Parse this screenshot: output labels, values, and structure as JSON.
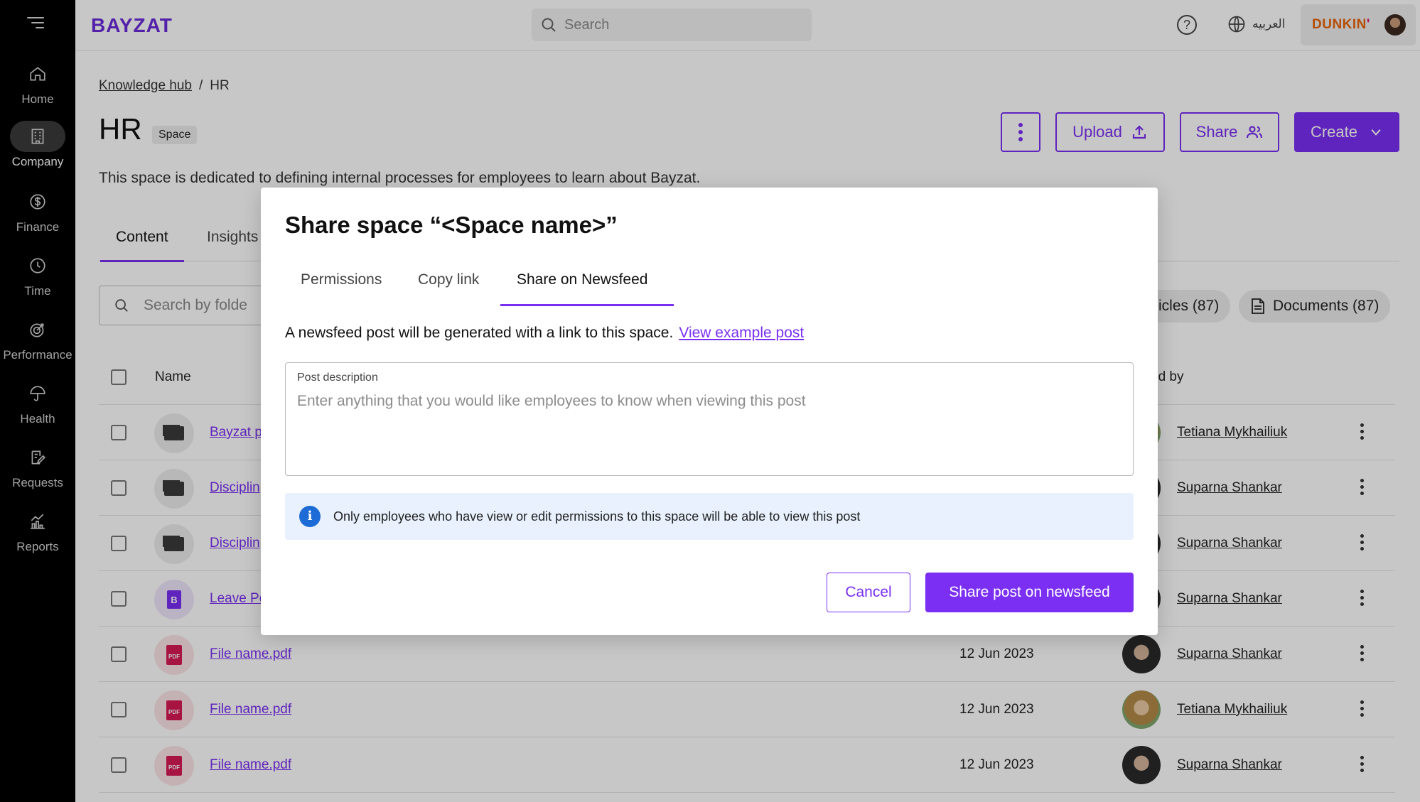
{
  "sidebar": {
    "items": [
      {
        "label": "Home",
        "icon": "home-icon"
      },
      {
        "label": "Company",
        "icon": "building-icon",
        "active": true
      },
      {
        "label": "Finance",
        "icon": "dollar-icon"
      },
      {
        "label": "Time",
        "icon": "clock-icon"
      },
      {
        "label": "Performance",
        "icon": "target-icon"
      },
      {
        "label": "Health",
        "icon": "umbrella-icon"
      },
      {
        "label": "Requests",
        "icon": "edit-icon"
      },
      {
        "label": "Reports",
        "icon": "bar-chart-icon"
      }
    ]
  },
  "topbar": {
    "logo": "BAYZAT",
    "search_placeholder": "Search",
    "help": "?",
    "language": "العربيه",
    "company_brand": "DUNKIN",
    "company_brand_suffix": "'"
  },
  "page": {
    "breadcrumb": [
      "Knowledge hub",
      "/",
      "HR"
    ],
    "title": "HR",
    "badge": "Space",
    "description": "This space is dedicated to defining internal processes for employees to learn about Bayzat.",
    "actions": {
      "upload": "Upload",
      "share": "Share",
      "create": "Create"
    },
    "tabs": [
      "Content",
      "Insights"
    ],
    "filter_placeholder": "Search by folde",
    "chips": [
      "icles (87)",
      "Documents (87)"
    ]
  },
  "table": {
    "headers": {
      "name": "Name",
      "by": "ed by"
    },
    "rows": [
      {
        "name": "Bayzat p",
        "date": "",
        "by": "Tetiana Mykhailiuk",
        "icon": "folder"
      },
      {
        "name": "Disciplin",
        "date": "",
        "by": "Suparna Shankar",
        "icon": "folder"
      },
      {
        "name": "Disciplin",
        "date": "",
        "by": "Suparna Shankar",
        "icon": "folder"
      },
      {
        "name": "Leave Po",
        "date": "",
        "by": "Suparna Shankar",
        "icon": "bdoc"
      },
      {
        "name": "File name.pdf",
        "date": "12 Jun 2023",
        "by": "Suparna Shankar",
        "icon": "pdf"
      },
      {
        "name": "File name.pdf",
        "date": "12 Jun 2023",
        "by": "Tetiana Mykhailiuk",
        "icon": "pdf"
      },
      {
        "name": "File name.pdf",
        "date": "12 Jun 2023",
        "by": "Suparna Shankar",
        "icon": "pdf"
      }
    ]
  },
  "modal": {
    "title": "Share space “<Space name>”",
    "tabs": [
      "Permissions",
      "Copy link",
      "Share on Newsfeed"
    ],
    "active_tab": "Share on Newsfeed",
    "intro": "A newsfeed post will be generated with a link to this space.",
    "example_link": "View example post",
    "field_label": "Post description",
    "field_placeholder": "Enter anything that you would like employees to know when viewing this post",
    "info_icon": "i",
    "info": "Only employees who have view or edit permissions to this space will be able to view this post",
    "cancel": "Cancel",
    "submit": "Share post on newsfeed"
  },
  "colors": {
    "accent": "#7a2ff2",
    "sidebar": "#000000",
    "info_bg": "#e8f1fd",
    "info_icon": "#1c6bd6"
  }
}
